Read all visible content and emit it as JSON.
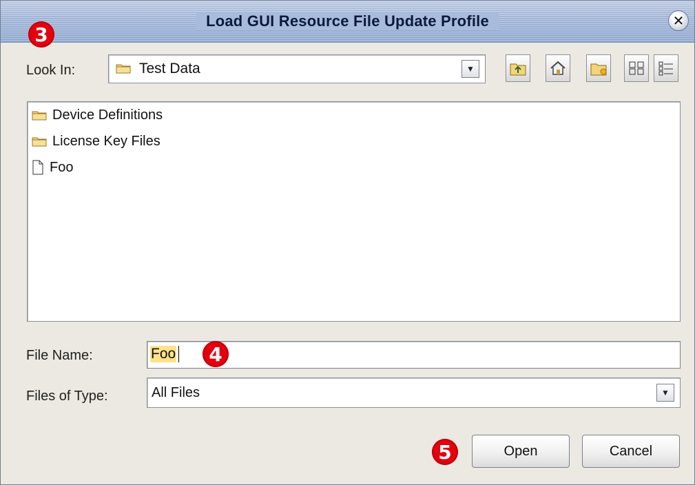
{
  "window": {
    "title": "Load GUI Resource File Update Profile"
  },
  "callouts": {
    "three": "3",
    "four": "4",
    "five": "5"
  },
  "look_in": {
    "label": "Look In:",
    "value": "Test Data"
  },
  "toolbar": {
    "icons": [
      "folder-up-icon",
      "home-icon",
      "new-folder-icon",
      "list-view-icon",
      "details-view-icon"
    ]
  },
  "files": [
    {
      "name": "Device Definitions",
      "type": "folder"
    },
    {
      "name": "License Key Files",
      "type": "folder"
    },
    {
      "name": "Foo",
      "type": "file"
    }
  ],
  "file_name": {
    "label": "File Name:",
    "value": "Foo"
  },
  "files_of_type": {
    "label": "Files of Type:",
    "value": "All Files"
  },
  "buttons": {
    "open": "Open",
    "cancel": "Cancel"
  },
  "colors": {
    "title_bar": "#9fb3d6",
    "dialog_bg": "#ebe9e1",
    "callout": "#e3000f",
    "selection": "#ffe28a"
  }
}
